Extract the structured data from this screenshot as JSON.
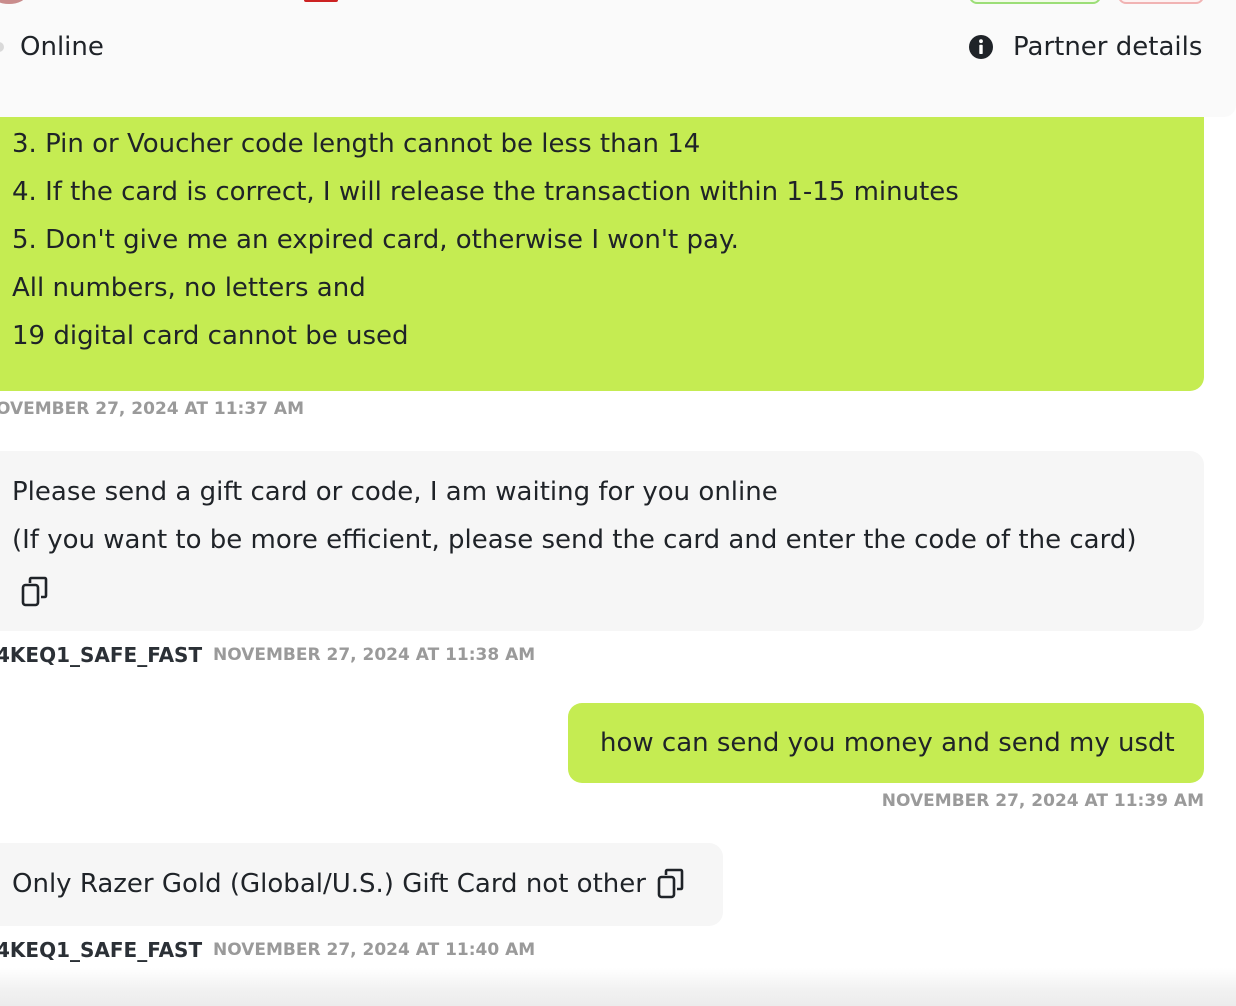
{
  "header": {
    "status": "Online",
    "partner_details_label": "Partner details",
    "colors": {
      "background": "#fafafa",
      "green_button_border": "#9cde77",
      "red_button_border": "#f1b3b3"
    }
  },
  "messages": [
    {
      "direction": "incoming",
      "lines": [
        "3. Pin or Voucher code length cannot be less than 14",
        "4. If the card is correct, I will release the transaction within 1-15 minutes",
        "5. Don't give me an expired card, otherwise I won't pay.",
        "All numbers, no letters and",
        "19 digital card cannot be used"
      ],
      "timestamp": "OVEMBER 27, 2024 AT 11:37 AM",
      "bubble_color": "#c5ec52"
    },
    {
      "direction": "incoming",
      "lines": [
        "Please send a gift card or code, I am waiting for you online",
        "(If you want to be more efficient, please send the card and enter the code of the card)"
      ],
      "copy_icon": "copy-icon",
      "sender": "4KEQ1_SAFE_FAST",
      "timestamp": "NOVEMBER 27, 2024 AT 11:38 AM",
      "bubble_color": "#f6f6f6"
    },
    {
      "direction": "outgoing",
      "text": "how can send you money and send my usdt",
      "timestamp": "NOVEMBER 27, 2024 AT 11:39 AM",
      "bubble_color": "#c5ec52"
    },
    {
      "direction": "incoming",
      "text": "Only Razer Gold (Global/U.S.) Gift Card not other",
      "copy_icon": "copy-icon",
      "sender": "4KEQ1_SAFE_FAST",
      "timestamp": "NOVEMBER 27, 2024 AT 11:40 AM",
      "bubble_color": "#f6f6f6"
    }
  ]
}
